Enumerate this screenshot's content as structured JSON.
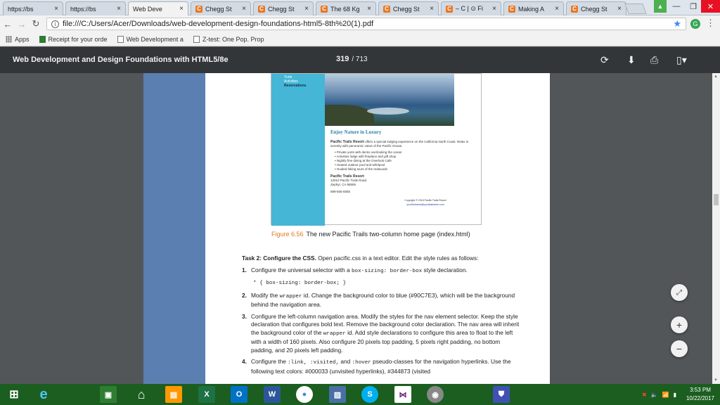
{
  "tabs": [
    {
      "title": "https://bs",
      "icon": "page-icon",
      "active": false
    },
    {
      "title": "https://bs",
      "icon": "page-icon",
      "active": false
    },
    {
      "title": "Web Deve",
      "icon": "page-icon",
      "active": true
    },
    {
      "title": "Chegg St",
      "icon": "chegg-icon",
      "active": false
    },
    {
      "title": "Chegg St",
      "icon": "chegg-icon",
      "active": false
    },
    {
      "title": "The 68 Kg",
      "icon": "chegg-icon",
      "active": false
    },
    {
      "title": "Chegg St",
      "icon": "chegg-icon",
      "active": false
    },
    {
      "title": "– C | ⊙ Fi",
      "icon": "chegg-icon",
      "active": false
    },
    {
      "title": "Making A",
      "icon": "chegg-icon",
      "active": false
    },
    {
      "title": "Chegg St",
      "icon": "chegg-icon",
      "active": false
    }
  ],
  "address": {
    "url": "file:///C:/Users/Acer/Downloads/web-development-design-foundations-html5-8th%20(1).pdf"
  },
  "bookmarks": {
    "apps": "Apps",
    "items": [
      {
        "label": "Receipt for your orde",
        "icon": "receipt-icon"
      },
      {
        "label": "Web Development a",
        "icon": "page-icon"
      },
      {
        "label": "Z-test: One Pop. Prop",
        "icon": "page-icon"
      }
    ]
  },
  "pdf": {
    "title": "Web Development and Design Foundations with HTML5/8e",
    "page": "319",
    "total": "/ 713"
  },
  "figure": {
    "nav": [
      "Yurts",
      "Activities",
      "Reservations"
    ],
    "heading": "Enjoy Nature in Luxury",
    "intro_bold": "Pacific Trails Resort",
    "intro_text": " offers a special lodging experience on the California North Coast. Relax in serenity with panoramic views of the Pacific Ocean.",
    "bullets": [
      "Private yurts with decks overlooking the ocean",
      "Activities lodge with fireplace and gift shop",
      "Nightly fine dining at the Overlook Cafe",
      "Heated outdoor pool and whirlpool",
      "Guided hiking tours of the redwoods"
    ],
    "contact_name": "Pacific Trails Resort",
    "contact_addr1": "12010 Pacific Trails Road",
    "contact_addr2": "Zephyr, CA 95555",
    "phone": "888-555-5555",
    "copyright": "Copyright © 2016 Pacific Trails Resort",
    "email": "yourfirstname@yourlastname.com"
  },
  "caption": {
    "label": "Figure 6.56",
    "text": "The new Pacific Trails two-column home page (index.html)"
  },
  "task": {
    "heading": "Task 2: Configure the CSS.",
    "intro": " Open pacific.css in a text editor. Edit the style rules as follows:",
    "item1_pre": "Configure the universal selector with a ",
    "item1_code": "box-sizing: border-box",
    "item1_post": " style declaration.",
    "codeline": "* { box-sizing: border-box; }",
    "item2_pre": "Modify the ",
    "item2_code": "wrapper",
    "item2_post": " id. Change the background color to blue (#90C7E3), which will be the background behind the navigation area.",
    "item3_pre": "Configure the left-column navigation area. Modify the styles for the nav element selector. Keep the style declaration that configures bold text. Remove the background color declaration. The nav area will inherit the background color of the ",
    "item3_code": "wrapper",
    "item3_post": " id. Add style declarations to configure this area to float to the left with a width of 160 pixels. Also configure 20 pixels top padding, 5 pixels right padding, no bottom padding, and 20 pixels left padding.",
    "item4_pre": "Configure the ",
    "item4_code": ":link, :visited,",
    "item4_mid": " and ",
    "item4_code2": ":hover",
    "item4_post": " pseudo-classes for the navigation hyperlinks. Use the following text colors: #000033 (unvisited hyperlinks), #344873 (visited"
  },
  "clock": {
    "time": "3:53 PM",
    "date": "10/22/2017"
  },
  "colors": {
    "figure_side": "#45b6d5",
    "caption_label": "#e07a1f",
    "taskbar": "#1b5e20"
  }
}
